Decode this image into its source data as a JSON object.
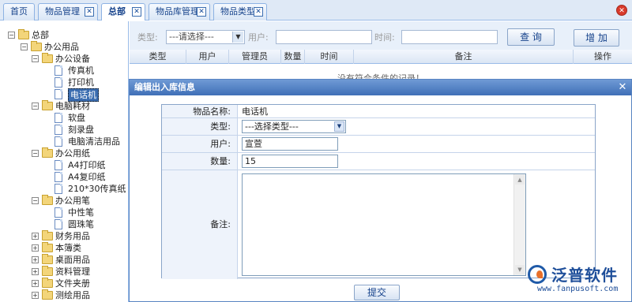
{
  "tabs": [
    {
      "label": "首页"
    },
    {
      "label": "物品管理"
    },
    {
      "label": "总部"
    },
    {
      "label": "物品库管理"
    },
    {
      "label": "物品类型"
    }
  ],
  "tree": {
    "root": "总部",
    "office": "办公用品",
    "equip": "办公设备",
    "fax": "传真机",
    "printer": "打印机",
    "phone": "电话机",
    "pc_consumables": "电脑耗材",
    "floppy": "软盘",
    "cd": "刻录盘",
    "cleaner": "电脑清洁用品",
    "paper": "办公用纸",
    "a4print": "A4打印纸",
    "a4copy": "A4复印纸",
    "faxpaper": "210*30传真纸",
    "pen": "办公用笔",
    "gelpen": "中性笔",
    "ballpen": "圆珠笔",
    "finance": "财务用品",
    "notebook": "本簿类",
    "desk": "桌面用品",
    "data": "资料管理",
    "folder": "文件夹册",
    "drawing": "测绘用品"
  },
  "filter": {
    "type_label": "类型:",
    "type_value": "---请选择---",
    "user_label": "用户:",
    "time_label": "时间:",
    "query_button": "查 询",
    "add_button": "增 加"
  },
  "grid": {
    "headers": [
      "类型",
      "用户",
      "管理员",
      "数量",
      "时间",
      "备注",
      "操作"
    ],
    "empty_text": "没有符合条件的记录！"
  },
  "dialog": {
    "title": "编辑出入库信息",
    "item_name_label": "物品名称:",
    "item_name_value": "电话机",
    "type_label": "类型:",
    "type_value": "---选择类型---",
    "user_label": "用户:",
    "user_value": "宣萱",
    "qty_label": "数量:",
    "qty_value": "15",
    "remark_label": "备注:",
    "submit_button": "提交"
  },
  "logo": {
    "name": "泛普软件",
    "url": "www.fanpusoft.com"
  }
}
